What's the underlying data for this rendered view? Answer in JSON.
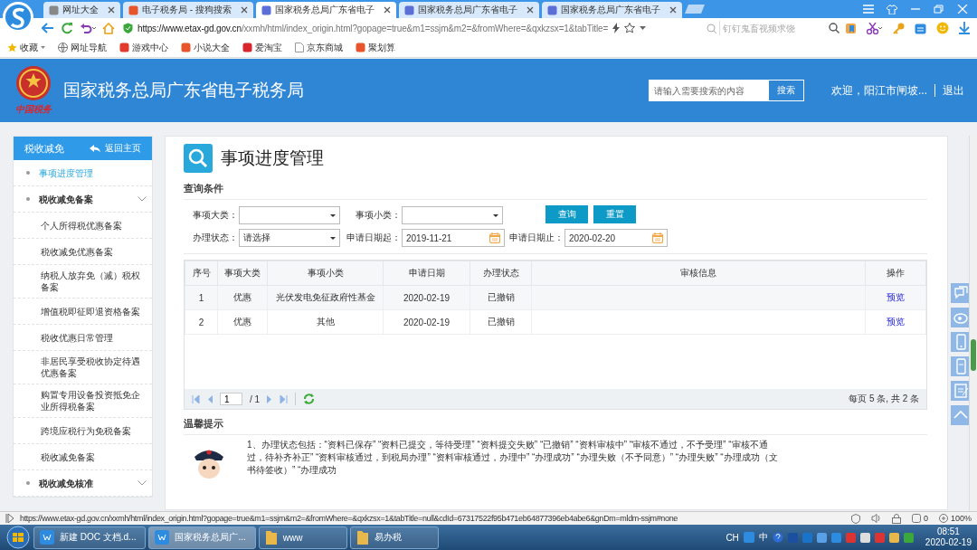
{
  "browser": {
    "tabs": [
      {
        "title": "网址大全",
        "selected": false
      },
      {
        "title": "电子税务局 - 搜狗搜索",
        "selected": false
      },
      {
        "title": "国家税务总局广东省电子",
        "selected": true
      },
      {
        "title": "国家税务总局广东省电子",
        "selected": false
      },
      {
        "title": "国家税务总局广东省电子",
        "selected": false
      }
    ],
    "address": "https://www.etax-gd.gov.cn/xxmh/html/index_origin.html?gopage=true&m1=ssjm&m2=&fromWhere=&qxkzsx=1&tabTitle=",
    "search_placeholder": "钉钉鬼畜视频求饶",
    "bookmarks": [
      "收藏",
      "网址导航",
      "游戏中心",
      "小说大全",
      "爱淘宝",
      "京东商城",
      "聚划算"
    ]
  },
  "header": {
    "logo_caption": "中国税务",
    "title": "国家税务总局广东省电子税务局",
    "search": {
      "placeholder": "请输入需要搜索的内容"
    },
    "search_button": "搜索",
    "welcome": "欢迎，阳江市闸坡...",
    "logout": "退出"
  },
  "sidebar": {
    "title": "税收减免",
    "back": "返回主页",
    "items": [
      {
        "label": "事项进度管理",
        "kind": "link",
        "selected": true
      },
      {
        "label": "税收减免备案",
        "kind": "group",
        "selected": false,
        "children": [
          {
            "label": "个人所得税优惠备案",
            "selected": false
          },
          {
            "label": "税收减免优惠备案",
            "selected": false
          },
          {
            "label": "纳税人放弃免（减）税权备案",
            "selected": false
          },
          {
            "label": "增值税即征即退资格备案",
            "selected": false
          },
          {
            "label": "税收优惠日常管理",
            "selected": false
          },
          {
            "label": "非居民享受税收协定待遇优惠备案",
            "selected": false
          },
          {
            "label": "购置专用设备投资抵免企业所得税备案",
            "selected": false
          },
          {
            "label": "跨境应税行为免税备案",
            "selected": false
          },
          {
            "label": "税收减免备案",
            "selected": false
          }
        ]
      },
      {
        "label": "税收减免核准",
        "kind": "group",
        "selected": false
      }
    ]
  },
  "main": {
    "title": "事项进度管理",
    "query_title": "查询条件",
    "fields": [
      {
        "label": "事项大类：",
        "kind": "select"
      },
      {
        "label": "事项小类：",
        "kind": "select"
      },
      {
        "label": "办理状态：",
        "kind": "select",
        "value": "请选择"
      },
      {
        "label": "申请日期起：",
        "kind": "date",
        "value": "2019-11-21"
      },
      {
        "label": "申请日期止：",
        "kind": "date",
        "value": "2020-02-20"
      }
    ],
    "buttons": [
      "查询",
      "重置"
    ],
    "table": {
      "columns": [
        "序号",
        "事项大类",
        "事项小类",
        "申请日期",
        "办理状态",
        "审核信息",
        "操作"
      ],
      "rows": [
        [
          "1",
          "优惠",
          "光伏发电免征政府性基金",
          "2020-02-19",
          "已撤销",
          "",
          "预览"
        ],
        [
          "2",
          "优惠",
          "其他",
          "2020-02-19",
          "已撤销",
          "",
          "预览"
        ]
      ]
    },
    "pager": {
      "page": "1",
      "total": "/ 1",
      "summary": "每页 5 条, 共 2 条"
    },
    "tips_title": "温馨提示",
    "tips": "1、办理状态包括：“资料已保存” “资料已提交，等待受理” “资料提交失败” “已撤销” “资料审核中” “审核不通过，不予受理” “审核不通过，待补齐补正” “资料审核通过，到税局办理” “资料审核通过，办理中” “办理成功” “办理失败（不予同意）” “办理失败” “办理成功（文书待签收）” “办理成功"
  },
  "status_bar": {
    "url": "https://www.etax-gd.gov.cn/xxmh/html/index_origin.html?gopage=true&m1=ssjm&m2=&fromWhere=&qxkzsx=1&tabTitle=null&cdId=67317522f95b471eb64877396eb4abe6&gnDm=mldm-ssjm#none",
    "blocked": "0",
    "zoom": "100%"
  },
  "taskbar": {
    "items": [
      {
        "label": "新建 DOC 文档.d...",
        "selected": false
      },
      {
        "label": "国家税务总局广...",
        "selected": true
      },
      {
        "label": "www",
        "selected": false
      },
      {
        "label": "易办税",
        "selected": false
      }
    ],
    "lang": "CH",
    "ime": "中",
    "time": "08:51",
    "date": "2020-02-19"
  }
}
